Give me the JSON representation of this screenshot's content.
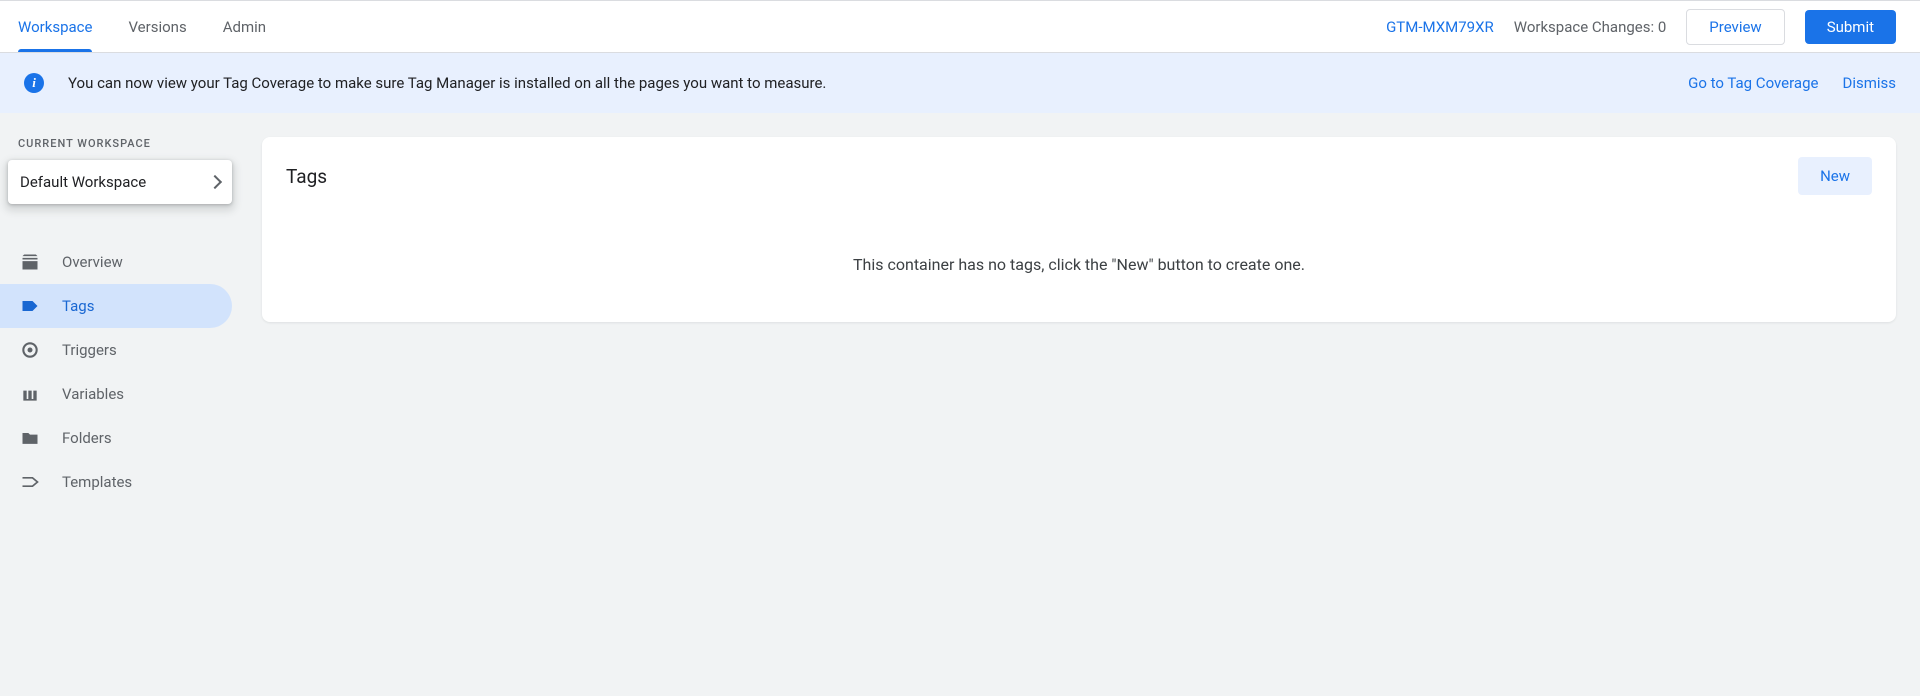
{
  "top_tabs": {
    "workspace": "Workspace",
    "versions": "Versions",
    "admin": "Admin"
  },
  "container_id": "GTM-MXM79XR",
  "changes_label": "Workspace Changes: 0",
  "preview_button": "Preview",
  "submit_button": "Submit",
  "banner": {
    "text": "You can now view your Tag Coverage to make sure Tag Manager is installed on all the pages you want to measure.",
    "goto": "Go to Tag Coverage",
    "dismiss": "Dismiss"
  },
  "sidebar": {
    "header": "Current Workspace",
    "selected_workspace": "Default Workspace",
    "items": [
      {
        "label": "Overview"
      },
      {
        "label": "Tags"
      },
      {
        "label": "Triggers"
      },
      {
        "label": "Variables"
      },
      {
        "label": "Folders"
      },
      {
        "label": "Templates"
      }
    ]
  },
  "main": {
    "title": "Tags",
    "new_button": "New",
    "empty_text": "This container has no tags, click the \"New\" button to create one."
  }
}
